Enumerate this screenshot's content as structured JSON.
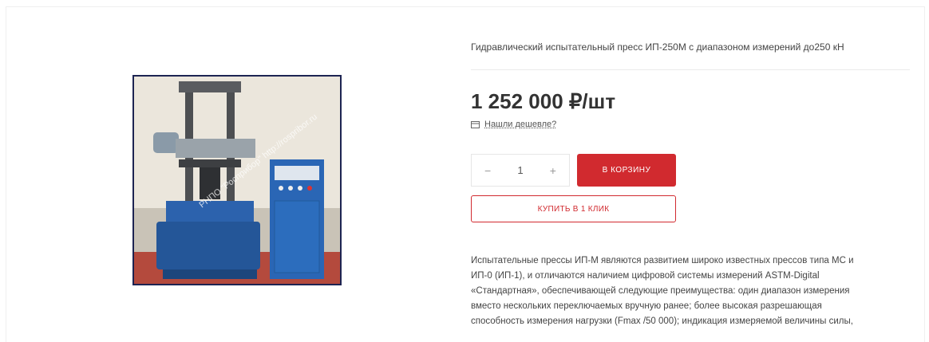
{
  "product": {
    "title": "Гидравлический испытательный пресс ИП-250М с диапазоном измерений до250 кН",
    "price": "1 252 000 ₽/шт",
    "cheaper_link": "Нашли дешевле?",
    "quantity": "1",
    "minus_symbol": "−",
    "plus_symbol": "+",
    "add_to_cart_label": "В КОРЗИНУ",
    "buy_one_click_label": "КУПИТЬ В 1 КЛИК",
    "description_lines": [
      "Испытательные прессы ИП-М являются развитием широко известных прессов типа МС и",
      "ИП-0 (ИП-1), и отличаются наличием цифровой системы измерений ASTM-Digital",
      "«Стандартная», обеспечивающей следующие преимущества: один диапазон измерения",
      "вместо нескольких переключаемых вручную ранее; более высокая разрешающая",
      "способность измерения нагрузки (Fmax /50 000); индикация измеряемой величины силы,"
    ]
  },
  "image": {
    "watermark": "РНПО \"Росприбор\" http://rospribor.ru"
  },
  "colors": {
    "accent_red": "#d12a2f",
    "image_border": "#1d2452",
    "machine_blue": "#1f5fa8"
  }
}
